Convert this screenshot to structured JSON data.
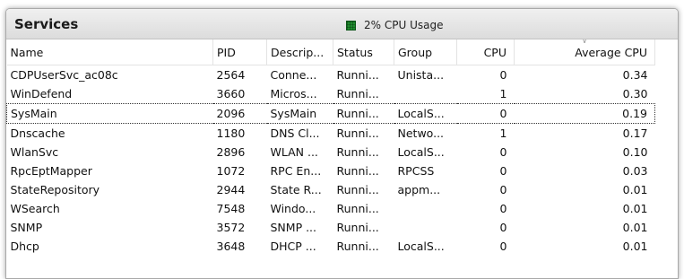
{
  "header": {
    "title": "Services",
    "cpu_usage": "2% CPU Usage",
    "cpu_icon": "cpu-graph-icon",
    "cpu_icon_color": "#1e8c2d"
  },
  "table": {
    "columns": [
      "Name",
      "PID",
      "Descrip...",
      "Status",
      "Group",
      "CPU",
      "Average CPU"
    ],
    "sorted_column": "Average CPU",
    "sort_direction": "descending",
    "selected_row": "SysMain",
    "rows": [
      [
        "CDPUserSvc_ac08c",
        "2564",
        "Conne...",
        "Runni...",
        "Unista...",
        "0",
        "0.34"
      ],
      [
        "WinDefend",
        "3660",
        "Micros...",
        "Runni...",
        "",
        "1",
        "0.30"
      ],
      [
        "SysMain",
        "2096",
        "SysMain",
        "Runni...",
        "LocalS...",
        "0",
        "0.19"
      ],
      [
        "Dnscache",
        "1180",
        "DNS Cl...",
        "Runni...",
        "Netwo...",
        "1",
        "0.17"
      ],
      [
        "WlanSvc",
        "2896",
        "WLAN ...",
        "Runni...",
        "LocalS...",
        "0",
        "0.10"
      ],
      [
        "RpcEptMapper",
        "1072",
        "RPC En...",
        "Runni...",
        "RPCSS",
        "0",
        "0.03"
      ],
      [
        "StateRepository",
        "2944",
        "State R...",
        "Runni...",
        "appm...",
        "0",
        "0.01"
      ],
      [
        "WSearch",
        "7548",
        "Windo...",
        "Runni...",
        "",
        "0",
        "0.01"
      ],
      [
        "SNMP",
        "3572",
        "SNMP ...",
        "Runni...",
        "",
        "0",
        "0.01"
      ],
      [
        "Dhcp",
        "3648",
        "DHCP ...",
        "Runni...",
        "LocalS...",
        "0",
        "0.01"
      ]
    ]
  }
}
